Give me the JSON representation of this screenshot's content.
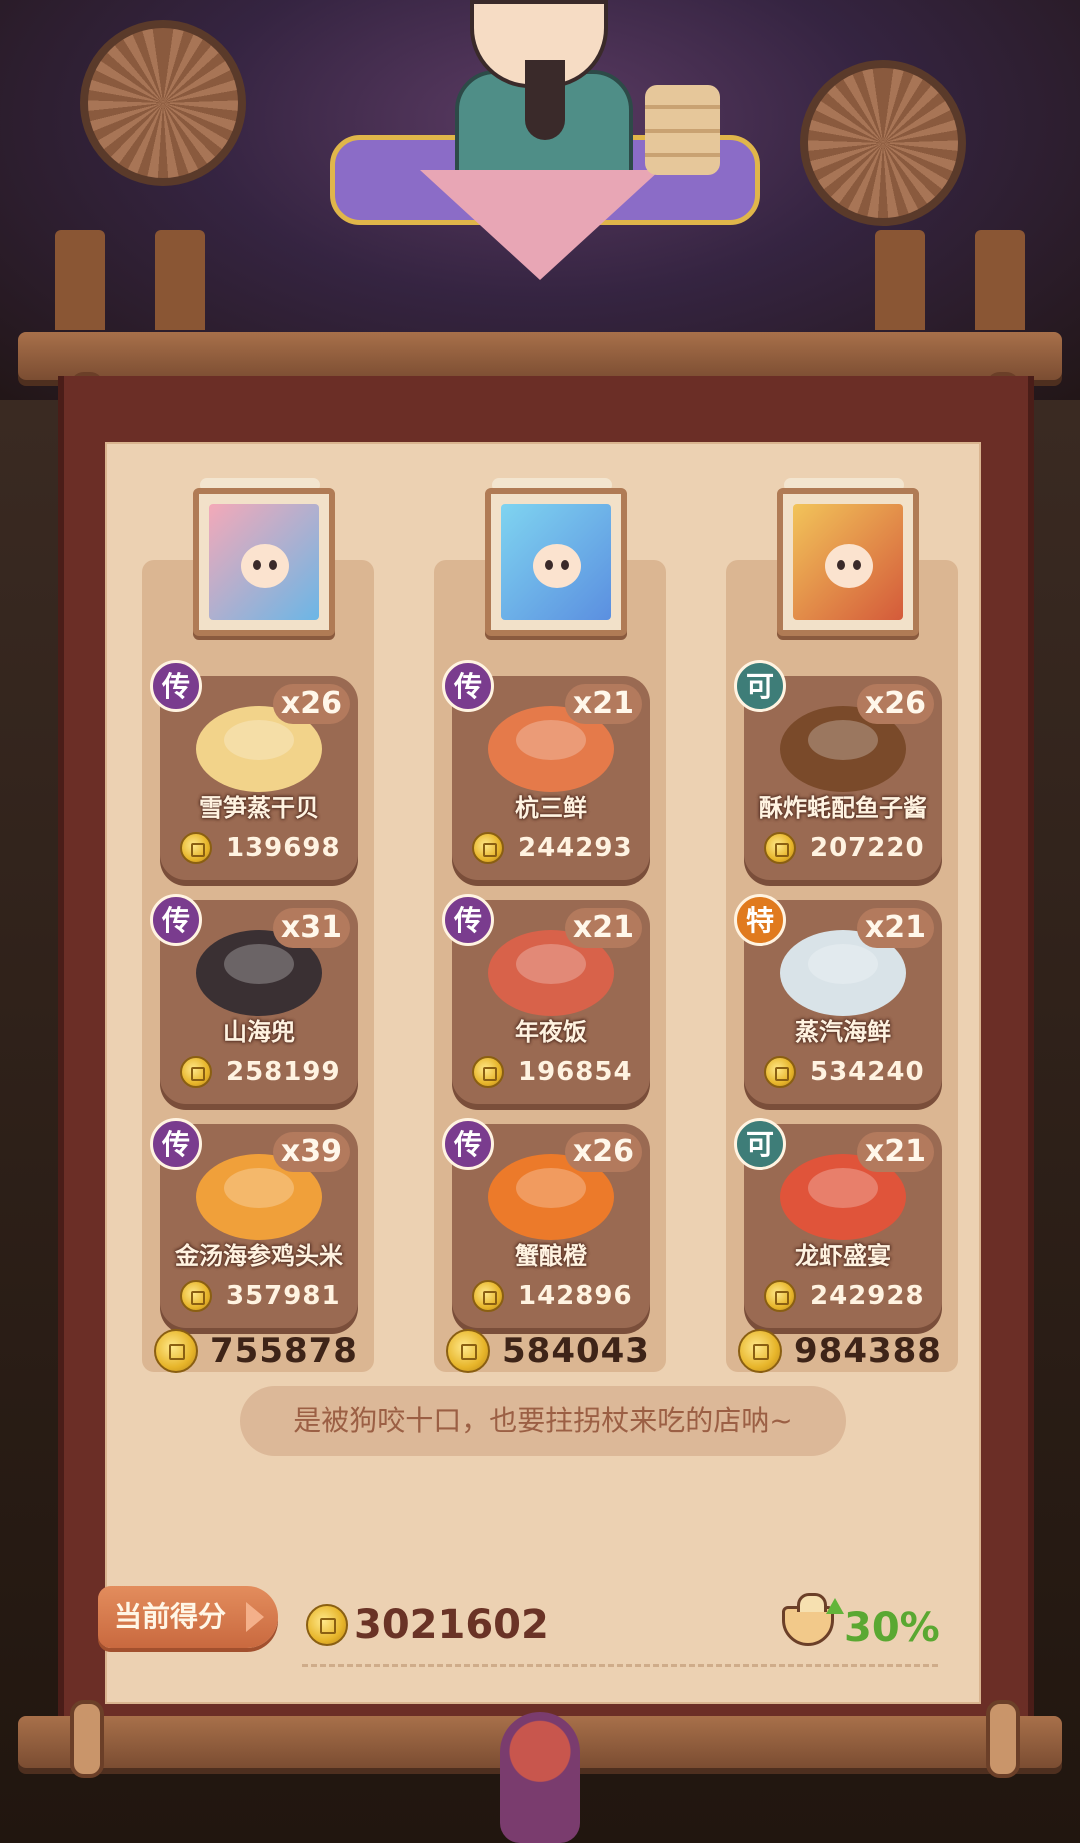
{
  "columns": [
    {
      "portrait_palette": [
        "#f4a9b8",
        "#6bb6e6"
      ],
      "dishes": [
        {
          "name": "雪笋蒸干贝",
          "count": "x26",
          "price": "139698",
          "rarity": "传",
          "rarity_color": "#7a3c8e",
          "plate": "#f2d38a"
        },
        {
          "name": "山海兜",
          "count": "x31",
          "price": "258199",
          "rarity": "传",
          "rarity_color": "#7a3c8e",
          "plate": "#3a3033"
        },
        {
          "name": "金汤海参鸡头米",
          "count": "x39",
          "price": "357981",
          "rarity": "传",
          "rarity_color": "#7a3c8e",
          "plate": "#f0a03a"
        }
      ],
      "total": "755878"
    },
    {
      "portrait_palette": [
        "#7fd4f0",
        "#5b8fe0"
      ],
      "dishes": [
        {
          "name": "杭三鲜",
          "count": "x21",
          "price": "244293",
          "rarity": "传",
          "rarity_color": "#7a3c8e",
          "plate": "#e57a4a"
        },
        {
          "name": "年夜饭",
          "count": "x21",
          "price": "196854",
          "rarity": "传",
          "rarity_color": "#7a3c8e",
          "plate": "#d8624a"
        },
        {
          "name": "蟹酿橙",
          "count": "x26",
          "price": "142896",
          "rarity": "传",
          "rarity_color": "#7a3c8e",
          "plate": "#ec7a2a"
        }
      ],
      "total": "584043"
    },
    {
      "portrait_palette": [
        "#f2c45a",
        "#d45a3a"
      ],
      "dishes": [
        {
          "name": "酥炸蚝配鱼子酱",
          "count": "x26",
          "price": "207220",
          "rarity": "可",
          "rarity_color": "#3e7d78",
          "plate": "#7a4a2a"
        },
        {
          "name": "蒸汽海鲜",
          "count": "x21",
          "price": "534240",
          "rarity": "特",
          "rarity_color": "#e07a1e",
          "plate": "#d9e3e8"
        },
        {
          "name": "龙虾盛宴",
          "count": "x21",
          "price": "242928",
          "rarity": "可",
          "rarity_color": "#3e7d78",
          "plate": "#e0543a"
        }
      ],
      "total": "984388"
    }
  ],
  "quote": "是被狗咬十口，也要拄拐杖来吃的店呐~",
  "score": {
    "label": "当前得分",
    "value": "3021602"
  },
  "bonus": {
    "icon": "full-belly-bowl-icon",
    "value": "30%"
  }
}
